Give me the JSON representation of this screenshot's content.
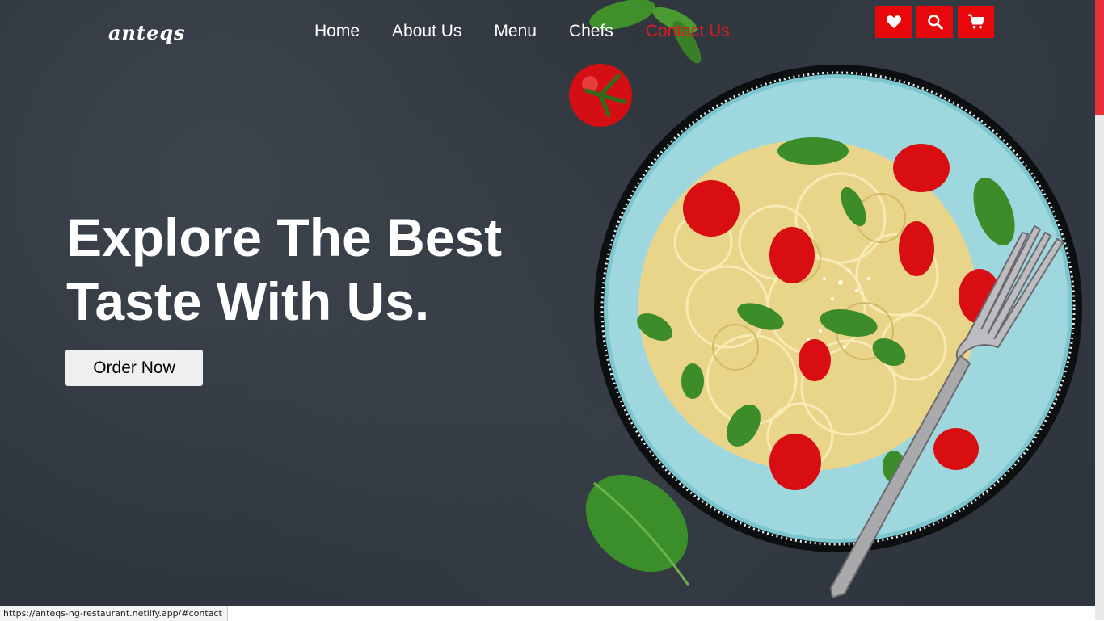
{
  "brand": {
    "logo_text": "anteqs"
  },
  "nav": {
    "items": [
      {
        "label": "Home"
      },
      {
        "label": "About Us"
      },
      {
        "label": "Menu"
      },
      {
        "label": "Chefs"
      },
      {
        "label": "Contact Us"
      }
    ],
    "active_index": 4
  },
  "header_icons": [
    "heart-icon",
    "search-icon",
    "cart-icon"
  ],
  "hero": {
    "headline_line1": "Explore The Best",
    "headline_line2": "Taste With Us.",
    "cta_label": "Order Now",
    "image": "pasta-plate-with-tomatoes-basil-and-fork"
  },
  "status_bar": {
    "url": "https://anteqs-ng-restaurant.netlify.app/#contact"
  },
  "colors": {
    "accent": "#e8080c",
    "background": "#2f353d",
    "button_bg": "#efefef",
    "text_light": "#ffffff"
  }
}
